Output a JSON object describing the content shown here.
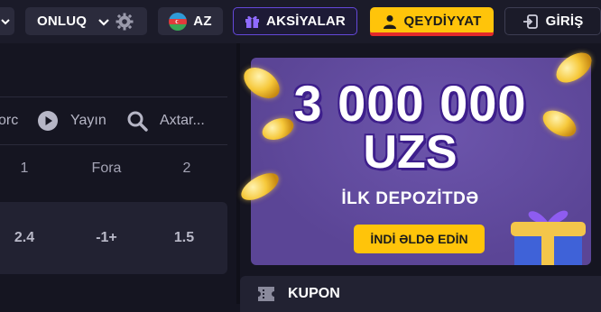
{
  "header": {
    "odds_format": "ONLUQ",
    "language": "AZ",
    "promotions_label": "AKSİYALAR",
    "register_label": "QEYDİYYAT",
    "login_label": "GİRİŞ"
  },
  "toolbar": {
    "partial_label": "orc",
    "stream_label": "Yayın",
    "search_label": "Axtar..."
  },
  "odds_table": {
    "headers": [
      "1",
      "Fora",
      "2"
    ],
    "row": [
      "2.4",
      "-1+",
      "1.5"
    ]
  },
  "banner": {
    "amount_line1": "3 000 000",
    "amount_line2": "UZS",
    "subtitle": "İLK DEPOZİTDƏ",
    "cta_label": "İNDİ ƏLDƏ EDİN"
  },
  "coupon": {
    "label": "KUPON"
  },
  "colors": {
    "accent": "#ffc40a",
    "banner": "#5b4596",
    "promo_border": "#6448d9",
    "register_underline": "#e32a2a"
  }
}
